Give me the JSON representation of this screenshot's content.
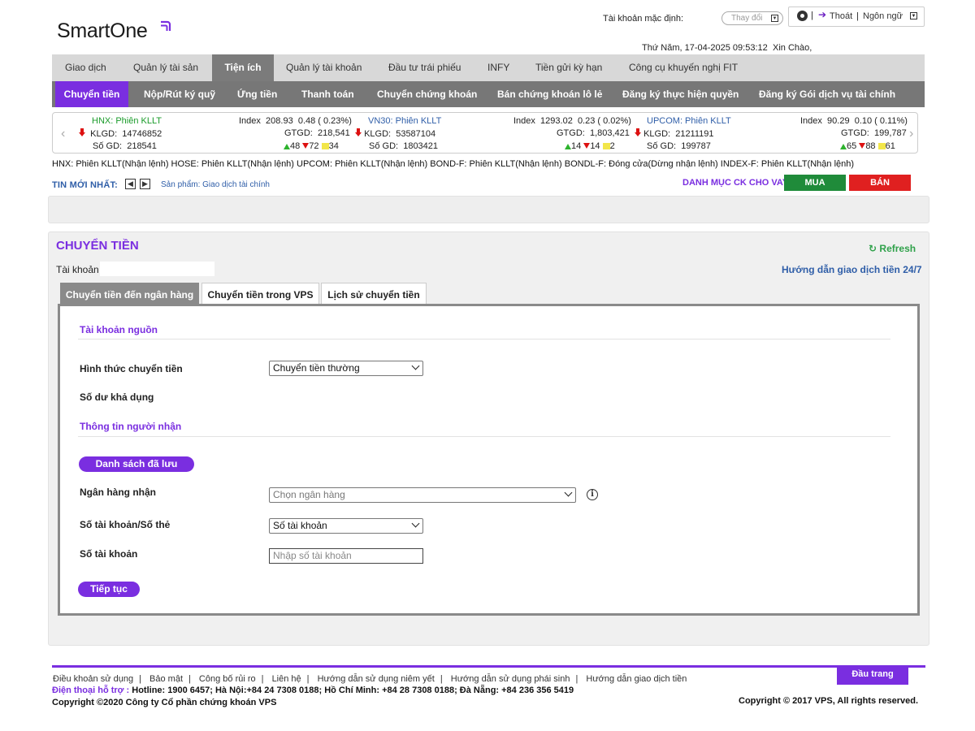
{
  "brand": {
    "name": "SmartOne",
    "accent": "#7a2ee0"
  },
  "header": {
    "account_default_label": "Tài khoản mặc định:",
    "change_label": "Thay đổi",
    "logout_label": "Thoát",
    "language_label": "Ngôn ngữ",
    "datetime": "Thứ Năm, 17-04-2025 09:53:12",
    "greeting": "Xin Chào,"
  },
  "main_nav": {
    "items": [
      {
        "label": "Giao dịch"
      },
      {
        "label": "Quản lý tài sản"
      },
      {
        "label": "Tiện ích"
      },
      {
        "label": "Quản lý tài khoản"
      },
      {
        "label": "Đầu tư trái phiếu"
      },
      {
        "label": "INFY"
      },
      {
        "label": "Tiền gửi kỳ hạn"
      },
      {
        "label": "Công cụ khuyến nghị FIT"
      }
    ],
    "active": "Tiện ích"
  },
  "sub_nav": {
    "items": [
      {
        "label": "Chuyển tiền"
      },
      {
        "label": "Nộp/Rút ký quỹ"
      },
      {
        "label": "Ứng tiền"
      },
      {
        "label": "Thanh toán"
      },
      {
        "label": "Chuyển chứng khoán"
      },
      {
        "label": "Bán chứng khoán lô lẻ"
      },
      {
        "label": "Đăng ký thực hiện quyền"
      },
      {
        "label": "Đăng ký Gói dịch vụ tài chính"
      }
    ],
    "active": "Chuyển tiền"
  },
  "ticker": {
    "hnx": {
      "name": "HNX: Phiên KLLT",
      "index_label": "Index",
      "index": "208.93",
      "change": "0.48 ( 0.23%)",
      "klgd_label": "KLGD:",
      "klgd": "14746852",
      "gtgd_label": "GTGD:",
      "gtgd": "218,541",
      "sogd_label": "Số GD:",
      "sogd": "218541",
      "up": "48",
      "down": "72",
      "ref": "34"
    },
    "vn30": {
      "name": "VN30: Phiên KLLT",
      "index_label": "Index",
      "index": "1293.02",
      "change": "0.23 ( 0.02%)",
      "klgd_label": "KLGD:",
      "klgd": "53587104",
      "gtgd_label": "GTGD:",
      "gtgd": "1,803,421",
      "sogd_label": "Số GD:",
      "sogd": "1803421",
      "up": "14",
      "down": "14",
      "ref": "2"
    },
    "upcom": {
      "name": "UPCOM: Phiên KLLT",
      "index_label": "Index",
      "index": "90.29",
      "change": "0.10 ( 0.11%)",
      "klgd_label": "KLGD:",
      "klgd": "21211191",
      "gtgd_label": "GTGD:",
      "gtgd": "199,787",
      "sogd_label": "Số GD:",
      "sogd": "199787",
      "up": "65",
      "down": "88",
      "ref": "61"
    }
  },
  "market_status": "HNX: Phiên KLLT(Nhận lệnh)   HOSE: Phiên KLLT(Nhận lệnh)   UPCOM: Phiên KLLT(Nhận lệnh)   BOND-F: Phiên KLLT(Nhận lệnh)   BONDL-F: Đóng cửa(Dừng nhận lệnh)   INDEX-F: Phiên KLLT(Nhận lệnh)",
  "news": {
    "label": "TIN MỚI NHẤT:",
    "prev": "◀",
    "next": "▶",
    "text": "Sản phẩm: Giao dịch tài chính"
  },
  "lending_list": "DANH MỤC CK CHO VAY",
  "buy_label": "MUA",
  "sell_label": "BÁN",
  "panel": {
    "title": "CHUYỂN TIỀN",
    "refresh_label": "Refresh",
    "account_label": "Tài khoản",
    "guide_link": "Hướng dẫn giao dịch tiền 24/7",
    "tabs": [
      {
        "label": "Chuyển tiền đến ngân hàng"
      },
      {
        "label": "Chuyển tiền trong VPS"
      },
      {
        "label": "Lịch sử chuyển tiền"
      }
    ],
    "active_tab": "Chuyển tiền đến ngân hàng",
    "source_section": "Tài khoản nguồn",
    "transfer_type_label": "Hình thức chuyển tiền",
    "transfer_type_value": "Chuyển tiền thường",
    "balance_label": "Số dư khả dụng",
    "recipient_section": "Thông tin người nhận",
    "saved_list_button": "Danh sách đã lưu",
    "bank_label": "Ngân hàng nhận",
    "bank_placeholder": "Chọn ngân hàng",
    "account_type_label": "Số tài khoản/Số thẻ",
    "account_type_value": "Số tài khoản",
    "account_no_label": "Số tài khoản",
    "account_no_placeholder": "Nhập số tài khoản",
    "continue_button": "Tiếp tục"
  },
  "footer": {
    "links": [
      {
        "label": "Điều khoản sử dụng"
      },
      {
        "label": "Bảo mật"
      },
      {
        "label": "Công bố rủi ro"
      },
      {
        "label": "Liên hệ"
      },
      {
        "label": "Hướng dẫn sử dụng niêm yết"
      },
      {
        "label": "Hướng dẫn sử dụng phái sinh"
      },
      {
        "label": "Hướng dẫn giao dịch tiền"
      }
    ],
    "top_button": "Đầu trang",
    "phone_label": "Điện thoại hỗ trợ :",
    "phone_text": "Hotline: 1900 6457; Hà Nội:+84 24 7308 0188; Hồ Chí Minh: +84 28 7308 0188; Đà Nẵng: +84 236 356 5419",
    "copyright_left": "Copyright ©2020 Công ty Cổ phần chứng khoán VPS",
    "copyright_right": "Copyright © 2017 VPS, All rights reserved."
  }
}
